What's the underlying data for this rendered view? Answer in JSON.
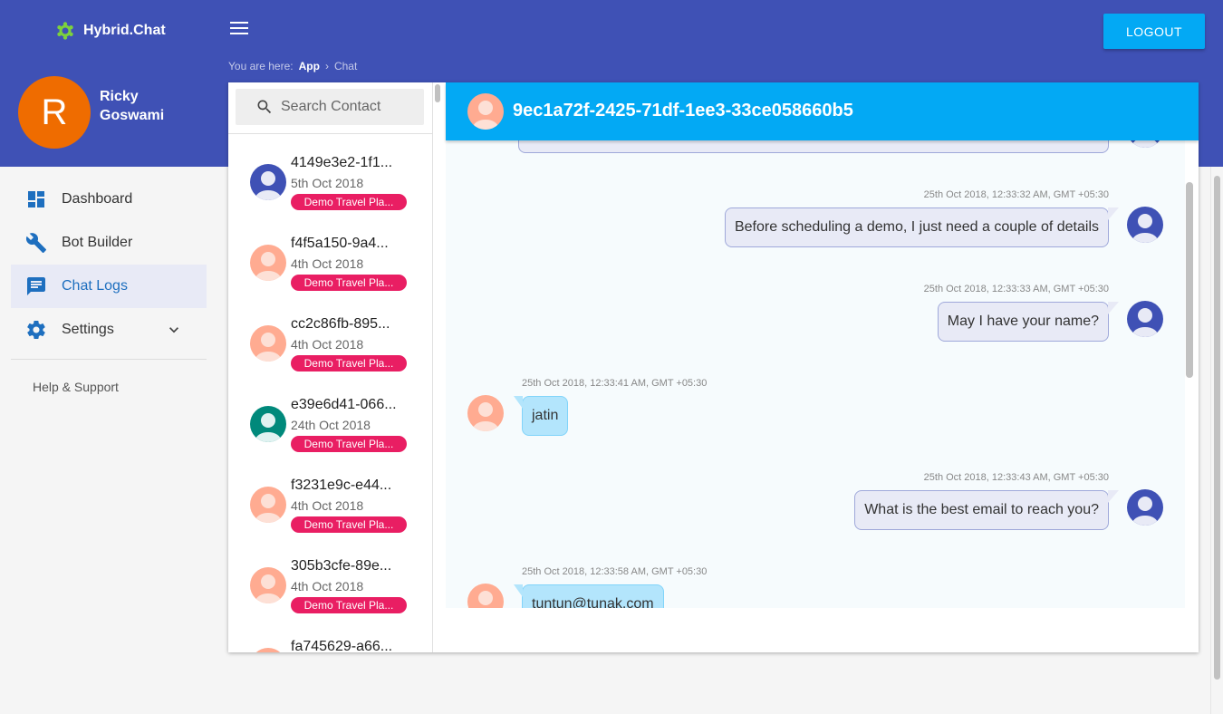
{
  "app": {
    "name": "Hybrid.Chat",
    "logout_label": "LOGOUT"
  },
  "breadcrumb": {
    "prefix": "You are here:",
    "app": "App",
    "separator": "›",
    "current": "Chat"
  },
  "user": {
    "initial": "R",
    "name": "Ricky Goswami",
    "avatar_color": "#ef6c00"
  },
  "nav": {
    "items": [
      {
        "label": "Dashboard",
        "icon": "dashboard-icon"
      },
      {
        "label": "Bot Builder",
        "icon": "wrench-icon"
      },
      {
        "label": "Chat Logs",
        "icon": "chat-icon"
      },
      {
        "label": "Settings",
        "icon": "gear-icon"
      }
    ],
    "help": "Help & Support"
  },
  "search": {
    "placeholder": "Search Contact"
  },
  "contacts": [
    {
      "id": "4149e3e2-1f1...",
      "date": "5th Oct 2018",
      "tag": "Demo Travel Pla...",
      "avatar_color": "#3f51b5"
    },
    {
      "id": "f4f5a150-9a4...",
      "date": "4th Oct 2018",
      "tag": "Demo Travel Pla...",
      "avatar_color": "#ffab91"
    },
    {
      "id": "cc2c86fb-895...",
      "date": "4th Oct 2018",
      "tag": "Demo Travel Pla...",
      "avatar_color": "#ffab91"
    },
    {
      "id": "e39e6d41-066...",
      "date": "24th Oct 2018",
      "tag": "Demo Travel Pla...",
      "avatar_color": "#00897b"
    },
    {
      "id": "f3231e9c-e44...",
      "date": "4th Oct 2018",
      "tag": "Demo Travel Pla...",
      "avatar_color": "#ffab91"
    },
    {
      "id": "305b3cfe-89e...",
      "date": "4th Oct 2018",
      "tag": "Demo Travel Pla...",
      "avatar_color": "#ffab91"
    },
    {
      "id": "fa745629-a66...",
      "date": "",
      "tag": "",
      "avatar_color": "#ffab91"
    }
  ],
  "chat": {
    "title": "9ec1a72f-2425-71df-1ee3-33ce058660b5",
    "header_color": "#03a9f4",
    "messages": [
      {
        "dir": "out",
        "time": "25th Oct 2018, 12:33:32 AM, GMT +05:30",
        "text": "Before scheduling a demo, I just need a couple of details"
      },
      {
        "dir": "out",
        "time": "25th Oct 2018, 12:33:33 AM, GMT +05:30",
        "text": "May I have your name?"
      },
      {
        "dir": "in",
        "time": "25th Oct 2018, 12:33:41 AM, GMT +05:30",
        "text": "jatin"
      },
      {
        "dir": "out",
        "time": "25th Oct 2018, 12:33:43 AM, GMT +05:30",
        "text": "What is the best email to reach you?"
      },
      {
        "dir": "in",
        "time": "25th Oct 2018, 12:33:58 AM, GMT +05:30",
        "text": "tuntun@tunak.com"
      }
    ]
  }
}
